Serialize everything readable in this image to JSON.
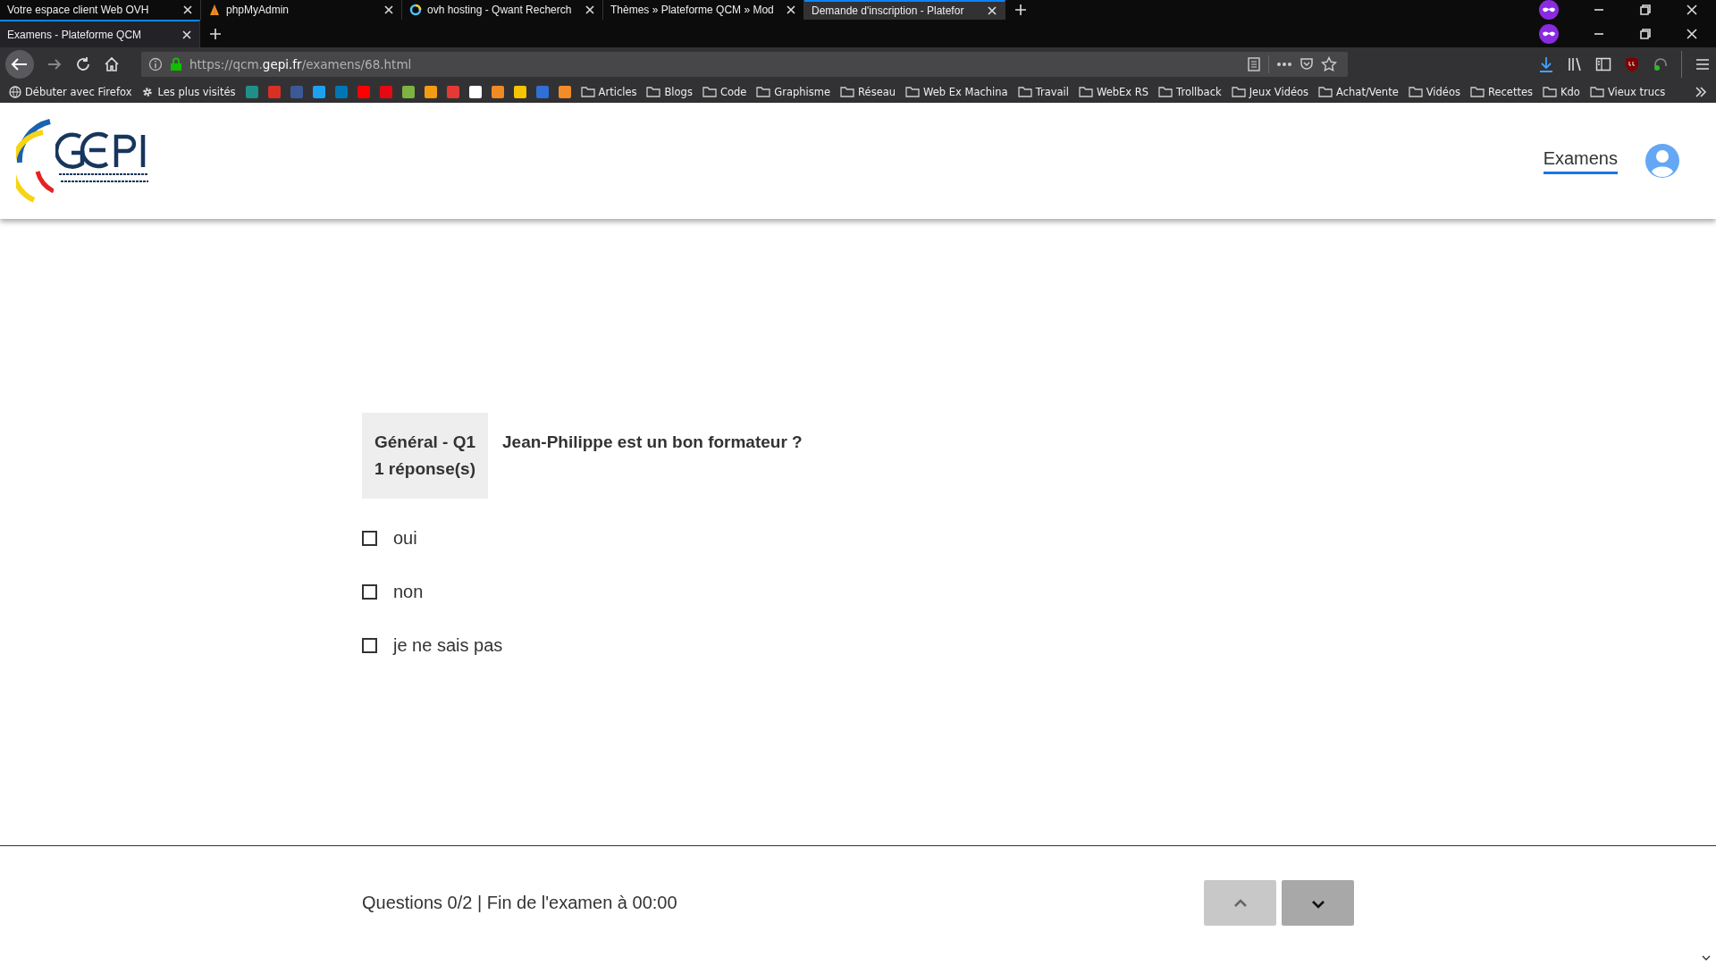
{
  "browser": {
    "back_tabs": [
      {
        "title": "Votre espace client Web OVH",
        "selected": false
      },
      {
        "title": "phpMyAdmin",
        "selected": false
      },
      {
        "title": "ovh hosting - Qwant Recherch",
        "selected": false
      },
      {
        "title": "Thèmes » Plateforme QCM » Mod",
        "selected": false
      },
      {
        "title": "Demande d'inscription - Platefor",
        "selected": true
      }
    ],
    "front_tabs": [
      {
        "title": "Examens - Plateforme QCM",
        "selected": true
      }
    ],
    "url": {
      "scheme": "https://qcm.",
      "domain": "gepi.fr",
      "path": "/examens/68.html"
    },
    "bookmarks": [
      {
        "kind": "link",
        "label": "Débuter avec Firefox"
      },
      {
        "kind": "link",
        "label": "Les plus visités"
      },
      {
        "kind": "icon",
        "color": "#1f8f8a"
      },
      {
        "kind": "icon",
        "color": "#d93025"
      },
      {
        "kind": "icon",
        "color": "#3b5998"
      },
      {
        "kind": "icon",
        "color": "#1da1f2"
      },
      {
        "kind": "icon",
        "color": "#0077b5"
      },
      {
        "kind": "icon",
        "color": "#ff0000"
      },
      {
        "kind": "icon",
        "color": "#e50914"
      },
      {
        "kind": "icon",
        "color": "#7cb342"
      },
      {
        "kind": "icon",
        "color": "#f39c12"
      },
      {
        "kind": "icon",
        "color": "#e53935"
      },
      {
        "kind": "icon",
        "color": "#ffffff"
      },
      {
        "kind": "icon",
        "color": "#f08a24"
      },
      {
        "kind": "icon",
        "color": "#f5c400"
      },
      {
        "kind": "icon",
        "color": "#2f6fd6"
      },
      {
        "kind": "icon",
        "color": "#f28c28"
      },
      {
        "kind": "folder",
        "label": "Articles"
      },
      {
        "kind": "folder",
        "label": "Blogs"
      },
      {
        "kind": "folder",
        "label": "Code"
      },
      {
        "kind": "folder",
        "label": "Graphisme"
      },
      {
        "kind": "folder",
        "label": "Réseau"
      },
      {
        "kind": "folder",
        "label": "Web Ex Machina"
      },
      {
        "kind": "folder",
        "label": "Travail"
      },
      {
        "kind": "folder",
        "label": "WebEx RS"
      },
      {
        "kind": "folder",
        "label": "Trollback"
      },
      {
        "kind": "folder",
        "label": "Jeux Vidéos"
      },
      {
        "kind": "folder",
        "label": "Achat/Vente"
      },
      {
        "kind": "folder",
        "label": "Vidéos"
      },
      {
        "kind": "folder",
        "label": "Recettes"
      },
      {
        "kind": "folder",
        "label": "Kdo"
      },
      {
        "kind": "folder",
        "label": "Vieux trucs"
      }
    ]
  },
  "header": {
    "nav": [
      {
        "label": "Examens",
        "selected": true
      }
    ]
  },
  "question": {
    "category": "Général - Q1",
    "answer_count": "1 réponse(s)",
    "text": "Jean-Philippe est un bon formateur ?",
    "options": [
      {
        "label": "oui",
        "checked": false
      },
      {
        "label": "non",
        "checked": false
      },
      {
        "label": "je ne sais pas",
        "checked": false
      }
    ]
  },
  "footer": {
    "status": "Questions 0/2 | Fin de l'examen à 00:00",
    "buttons": [
      {
        "kind": "up",
        "disabled": true
      },
      {
        "kind": "down",
        "disabled": false
      }
    ]
  }
}
